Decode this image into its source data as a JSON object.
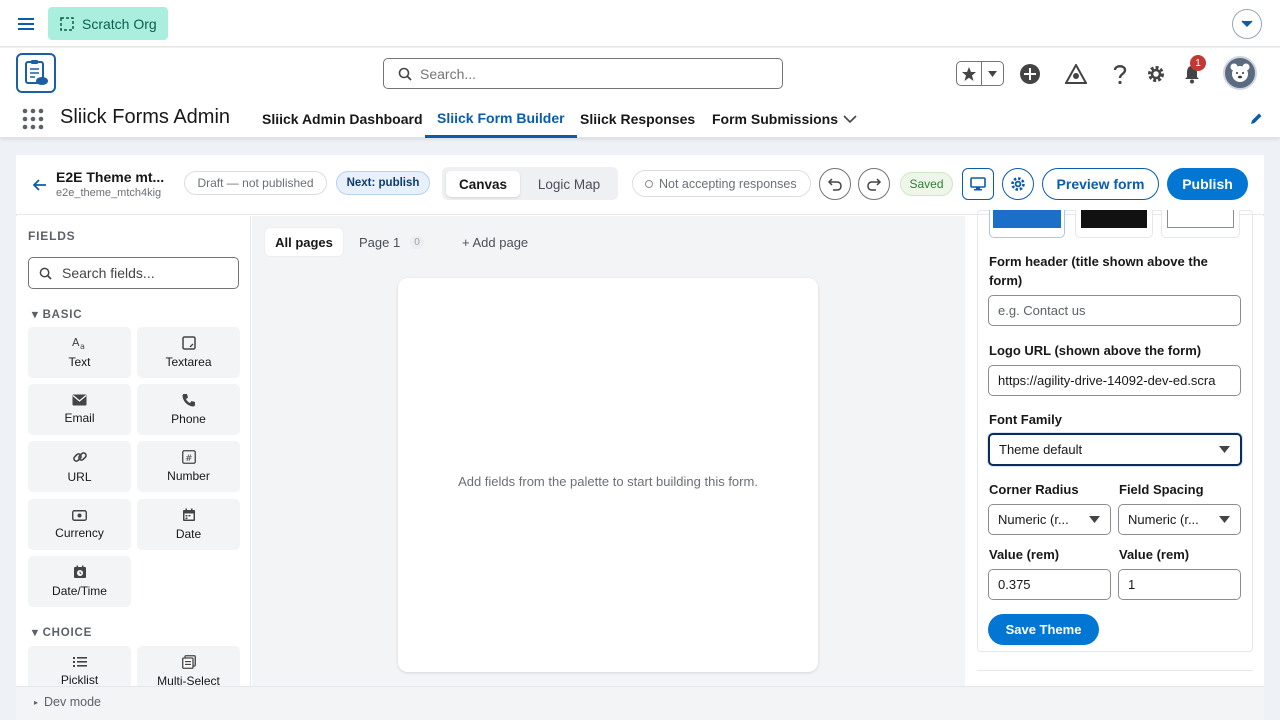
{
  "topbar": {
    "org_label": "Scratch Org"
  },
  "header": {
    "search_placeholder": "Search...",
    "notification_count": "1"
  },
  "nav": {
    "app_name": "Sliick Forms Admin",
    "tabs": [
      {
        "label": "Sliick Admin Dashboard"
      },
      {
        "label": "Sliick Form Builder"
      },
      {
        "label": "Sliick Responses"
      },
      {
        "label": "Form Submissions"
      }
    ]
  },
  "toolbar": {
    "form_title": "E2E Theme mt...",
    "form_api_name": "e2e_theme_mtch4kig",
    "draft_status": "Draft — not published",
    "next_step": "Next: publish",
    "view_tabs": [
      "Canvas",
      "Logic Map"
    ],
    "accepting": "Not accepting responses",
    "saved": "Saved",
    "preview_label": "Preview form",
    "publish_label": "Publish"
  },
  "palette": {
    "heading": "FIELDS",
    "search_placeholder": "Search fields...",
    "groups": [
      {
        "name": "BASIC",
        "items": [
          {
            "label": "Text",
            "icon": "text-icon"
          },
          {
            "label": "Textarea",
            "icon": "textarea-icon"
          },
          {
            "label": "Email",
            "icon": "email-icon"
          },
          {
            "label": "Phone",
            "icon": "phone-icon"
          },
          {
            "label": "URL",
            "icon": "link-icon"
          },
          {
            "label": "Number",
            "icon": "number-icon"
          },
          {
            "label": "Currency",
            "icon": "currency-icon"
          },
          {
            "label": "Date",
            "icon": "calendar-icon"
          },
          {
            "label": "Date/Time",
            "icon": "datetime-icon"
          }
        ]
      },
      {
        "name": "CHOICE",
        "items": [
          {
            "label": "Picklist",
            "icon": "list-icon"
          },
          {
            "label": "Multi-Select",
            "icon": "multiselect-icon"
          }
        ]
      }
    ]
  },
  "canvas": {
    "page_tabs": {
      "all": "All pages",
      "page1": "Page 1",
      "page1_count": "0",
      "add": "+ Add page"
    },
    "empty_message": "Add fields from the palette to start building this form."
  },
  "properties": {
    "swatch_colors": [
      "#1b6fc8",
      "#111111",
      "#ffffff"
    ],
    "form_header_label": "Form header (title shown above the form)",
    "form_header_placeholder": "e.g. Contact us",
    "logo_url_label": "Logo URL (shown above the form)",
    "logo_url_value": "https://agility-drive-14092-dev-ed.scra",
    "font_family_label": "Font Family",
    "font_family_value": "Theme default",
    "corner_radius_label": "Corner Radius",
    "corner_radius_value": "Numeric (r...",
    "field_spacing_label": "Field Spacing",
    "field_spacing_value": "Numeric (r...",
    "value_label_1": "Value (rem)",
    "value_1": "0.375",
    "value_label_2": "Value (rem)",
    "value_2": "1",
    "save_label": "Save Theme"
  },
  "footer": {
    "dev_mode": "Dev mode"
  },
  "colors": {
    "brand": "#0176d3",
    "active_tab": "#0b5cab",
    "org_badge": "#aaeede"
  }
}
